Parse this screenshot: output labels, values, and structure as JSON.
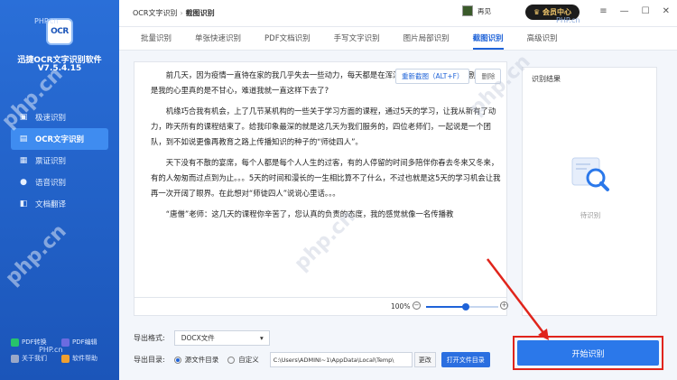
{
  "sidebar": {
    "logo_text": "OCR",
    "app_name": "迅捷OCR文字识别软件",
    "version": "V7.5.4.15",
    "items": [
      {
        "label": "极速识别",
        "icon": "scan-icon"
      },
      {
        "label": "OCR文字识别",
        "icon": "ocr-icon"
      },
      {
        "label": "票证识别",
        "icon": "ticket-icon"
      },
      {
        "label": "语音识别",
        "icon": "mic-icon"
      },
      {
        "label": "文档翻译",
        "icon": "translate-icon"
      }
    ],
    "bottom_links": [
      {
        "label": "PDF转换",
        "color": "#27c46b"
      },
      {
        "label": "PDF编辑",
        "color": "#6b6be0"
      },
      {
        "label": "关于我们",
        "color": "#9aa8c8"
      },
      {
        "label": "软件帮助",
        "color": "#f0a030"
      }
    ]
  },
  "header": {
    "breadcrumb_parent": "OCR文字识别",
    "breadcrumb_current": "截图识别",
    "user_name": "再见",
    "vip_label": "会员中心",
    "window_controls": [
      "≡",
      "—",
      "☐",
      "✕"
    ]
  },
  "tabs": [
    {
      "label": "批量识别",
      "active": false
    },
    {
      "label": "单张快速识别",
      "active": false
    },
    {
      "label": "PDF文档识别",
      "active": false
    },
    {
      "label": "手写文字识别",
      "active": false
    },
    {
      "label": "图片局部识别",
      "active": false
    },
    {
      "label": "截图识别",
      "active": true
    },
    {
      "label": "高级识别",
      "active": false
    }
  ],
  "doc": {
    "paragraphs": [
      "前几天，因为疫情一直待在家的我几乎失去一些动力，每天都是在浑浑噩噩的度日，最后追剧。。。可是我的心里真的是不甘心，难道我就一直这样下去了?",
      "机缘巧合我有机会，上了几节某机构的一些关于学习方面的课程，通过5天的学习，让我从新有了动力，昨天所有的课程结束了。给我印象最深的就是这几天为我们服务的，四位老师们，一起说是一个团队，到不如说更像再教育之路上传播知识的种子的“师徒四人”。",
      "天下没有不散的宴席，每个人都是每个人人生的过客，有的人停留的时间多陪伴你春去冬来又冬来，有的人匆匆而过点到为止。。。5天的时间和漫长的一生相比算不了什么，不过也就是这5天的学习机会让我再一次开阔了眼界。在此想对“师徒四人”说说心里话。。。",
      "“唐僧”老师：这几天的课程你辛苦了，您认真的负责的态度，我的感觉就像一名传播教"
    ],
    "rescan_label": "重新截图（ALT+F）",
    "delete_label": "删除",
    "zoom_level": "100%",
    "zoom_minus": "−",
    "zoom_plus": "+",
    "zoom_fraction": 0.55
  },
  "result": {
    "title": "识别结果",
    "status": "待识别"
  },
  "export": {
    "format_label": "导出格式:",
    "format_value": "DOCX文件",
    "dir_label": "导出目录:",
    "option_source": "源文件目录",
    "option_custom": "自定义",
    "path": "C:\\Users\\ADMINI~1\\AppData\\Local\\Temp\\",
    "change_label": "更改",
    "open_label": "打开文件目录"
  },
  "start_label": "开始识别",
  "watermarks": [
    "php.cn",
    "php.cn",
    "php.cn",
    "php.cn"
  ],
  "watermark_small": [
    "PHP.cn",
    "PHP.cn",
    "PHP.cn"
  ],
  "colors": {
    "accent": "#1f63d8",
    "highlight": "#e0241b",
    "sidebar": "#1b55b9"
  }
}
